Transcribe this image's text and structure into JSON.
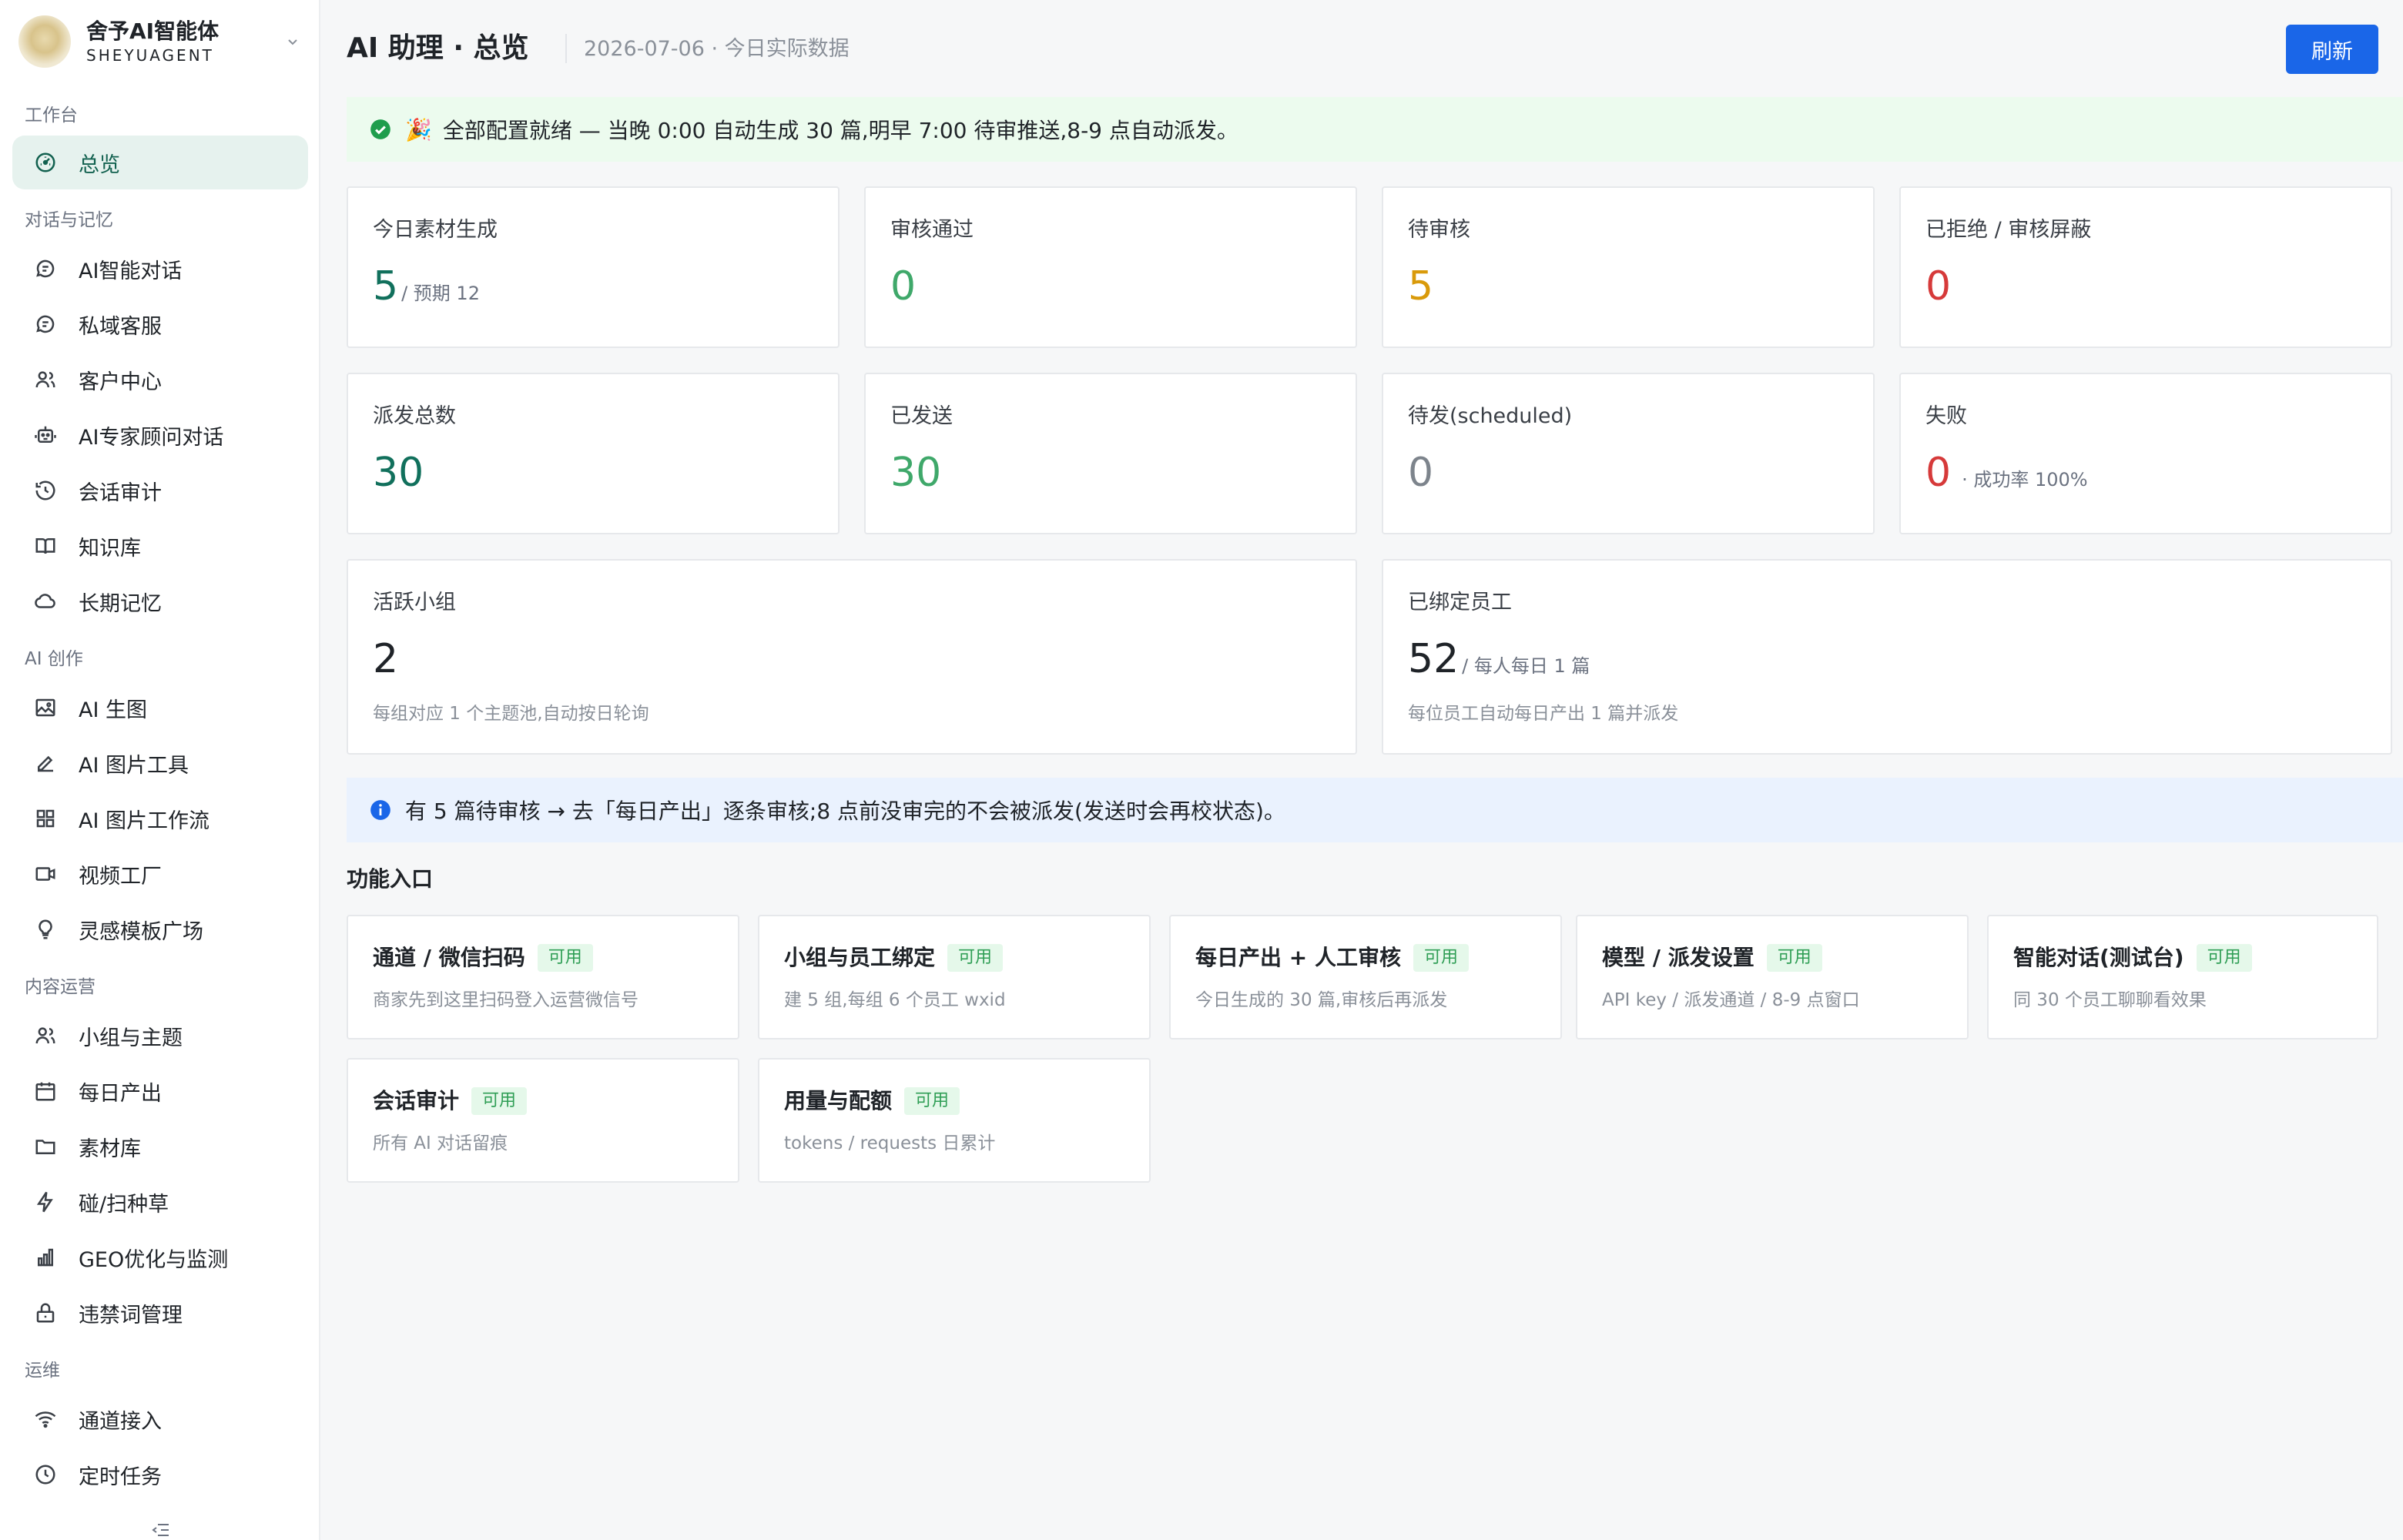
{
  "brand": {
    "name": "舍予AI智能体",
    "sub": "SHEYUAGENT"
  },
  "sidebar": {
    "sections": [
      {
        "title": "工作台",
        "items": [
          {
            "label": "总览",
            "icon": "dashboard-icon",
            "active": true
          }
        ]
      },
      {
        "title": "对话与记忆",
        "items": [
          {
            "label": "AI智能对话",
            "icon": "chat-icon"
          },
          {
            "label": "私域客服",
            "icon": "chat-icon"
          },
          {
            "label": "客户中心",
            "icon": "users-icon"
          },
          {
            "label": "AI专家顾问对话",
            "icon": "robot-icon"
          },
          {
            "label": "会话审计",
            "icon": "history-icon"
          },
          {
            "label": "知识库",
            "icon": "book-icon"
          },
          {
            "label": "长期记忆",
            "icon": "cloud-icon"
          }
        ]
      },
      {
        "title": "AI 创作",
        "items": [
          {
            "label": "AI 生图",
            "icon": "image-icon"
          },
          {
            "label": "AI 图片工具",
            "icon": "pen-icon"
          },
          {
            "label": "AI 图片工作流",
            "icon": "grid-icon"
          },
          {
            "label": "视频工厂",
            "icon": "video-icon"
          },
          {
            "label": "灵感模板广场",
            "icon": "bulb-icon"
          }
        ]
      },
      {
        "title": "内容运营",
        "items": [
          {
            "label": "小组与主题",
            "icon": "users-icon"
          },
          {
            "label": "每日产出",
            "icon": "calendar-icon"
          },
          {
            "label": "素材库",
            "icon": "folder-icon"
          },
          {
            "label": "碰/扫种草",
            "icon": "bolt-icon"
          },
          {
            "label": "GEO优化与监测",
            "icon": "bar-chart-icon"
          },
          {
            "label": "违禁词管理",
            "icon": "lock-icon"
          }
        ]
      },
      {
        "title": "运维",
        "items": [
          {
            "label": "通道接入",
            "icon": "wifi-icon"
          },
          {
            "label": "定时任务",
            "icon": "clock-icon"
          }
        ]
      }
    ]
  },
  "header": {
    "title": "AI 助理 · 总览",
    "subtitle": "2026-07-06 · 今日实际数据",
    "refresh_label": "刷新"
  },
  "banners": {
    "success": "全部配置就绪 — 当晚 0:00 自动生成 30 篇,明早 7:00 待审推送,8-9 点自动派发。",
    "success_emoji": "🎉",
    "info": "有 5 篇待审核 → 去「每日产出」逐条审核;8 点前没审完的不会被派发(发送时会再校状态)。"
  },
  "stats": {
    "today_generated": {
      "label": "今日素材生成",
      "value": "5",
      "suffix": "/ 预期 12"
    },
    "approved": {
      "label": "审核通过",
      "value": "0"
    },
    "pending": {
      "label": "待审核",
      "value": "5"
    },
    "rejected": {
      "label": "已拒绝 / 审核屏蔽",
      "value": "0"
    },
    "dispatch_total": {
      "label": "派发总数",
      "value": "30"
    },
    "sent": {
      "label": "已发送",
      "value": "30"
    },
    "scheduled": {
      "label": "待发(scheduled)",
      "value": "0"
    },
    "failed": {
      "label": "失败",
      "value": "0",
      "suffix": "· 成功率 100%"
    },
    "active_groups": {
      "label": "活跃小组",
      "value": "2",
      "note": "每组对应 1 个主题池,自动按日轮询"
    },
    "bound_staff": {
      "label": "已绑定员工",
      "value": "52",
      "suffix": "/ 每人每日 1 篇",
      "note": "每位员工自动每日产出 1 篇并派发"
    }
  },
  "features": {
    "title": "功能入口",
    "items": [
      {
        "title": "通道 / 微信扫码",
        "badge": "可用",
        "desc": "商家先到这里扫码登入运营微信号"
      },
      {
        "title": "小组与员工绑定",
        "badge": "可用",
        "desc": "建 5 组,每组 6 个员工 wxid"
      },
      {
        "title": "每日产出 + 人工审核",
        "badge": "可用",
        "desc": "今日生成的 30 篇,审核后再派发"
      },
      {
        "title": "模型 / 派发设置",
        "badge": "可用",
        "desc": "API key / 派发通道 / 8-9 点窗口"
      },
      {
        "title": "智能对话(测试台)",
        "badge": "可用",
        "desc": "同 30 个员工聊聊看效果"
      },
      {
        "title": "会话审计",
        "badge": "可用",
        "desc": "所有 AI 对话留痕"
      },
      {
        "title": "用量与配额",
        "badge": "可用",
        "desc": "tokens / requests 日累计"
      }
    ]
  },
  "colors": {
    "primary": "#1a66e8",
    "teal": "#11705c",
    "green": "#3fa86a",
    "orange": "#d99a0a",
    "red": "#d63a3a",
    "success_bg": "#ecfbee",
    "info_bg": "#eaf2fe"
  }
}
